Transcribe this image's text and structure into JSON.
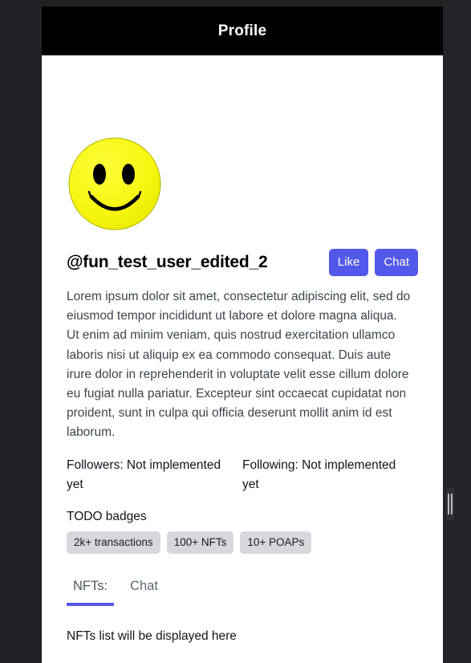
{
  "app_bar": {
    "title": "Profile"
  },
  "colors": {
    "app_bar_bg": "#000000",
    "page_bg": "#202124",
    "panel_bg": "#ffffff",
    "accent": "#5258ea",
    "badge_bg": "#d6d8dc",
    "bio_text": "#3e444c",
    "tab_inactive": "#5f6872"
  },
  "profile": {
    "avatar_icon": "smiley-face-avatar",
    "username": "@fun_test_user_edited_2",
    "actions": [
      {
        "id": "like",
        "label": "Like"
      },
      {
        "id": "chat",
        "label": "Chat"
      }
    ],
    "bio": "Lorem ipsum dolor sit amet, consectetur adipiscing elit, sed do eiusmod tempor incididunt ut labore et dolore magna aliqua. Ut enim ad minim veniam, quis nostrud exercitation ullamco laboris nisi ut aliquip ex ea commodo consequat. Duis aute irure dolor in reprehenderit in voluptate velit esse cillum dolore eu fugiat nulla pariatur. Excepteur sint occaecat cupidatat non proident, sunt in culpa qui officia deserunt mollit anim id est laborum.",
    "stats": [
      {
        "id": "followers",
        "text": "Followers: Not implemented yet"
      },
      {
        "id": "following",
        "text": "Following: Not implemented yet"
      }
    ],
    "badges_title": "TODO badges",
    "badges": [
      {
        "id": "transactions",
        "label": "2k+ transactions"
      },
      {
        "id": "nfts",
        "label": "100+ NFTs"
      },
      {
        "id": "poaps",
        "label": "10+ POAPs"
      }
    ]
  },
  "tabs": {
    "items": [
      {
        "id": "nfts",
        "label": "NFTs:",
        "active": true
      },
      {
        "id": "chat",
        "label": "Chat",
        "active": false
      }
    ],
    "panel_text": "NFTs list will be displayed here"
  },
  "chrome": {
    "drag_handle_icon": "vertical-grip-icon"
  }
}
